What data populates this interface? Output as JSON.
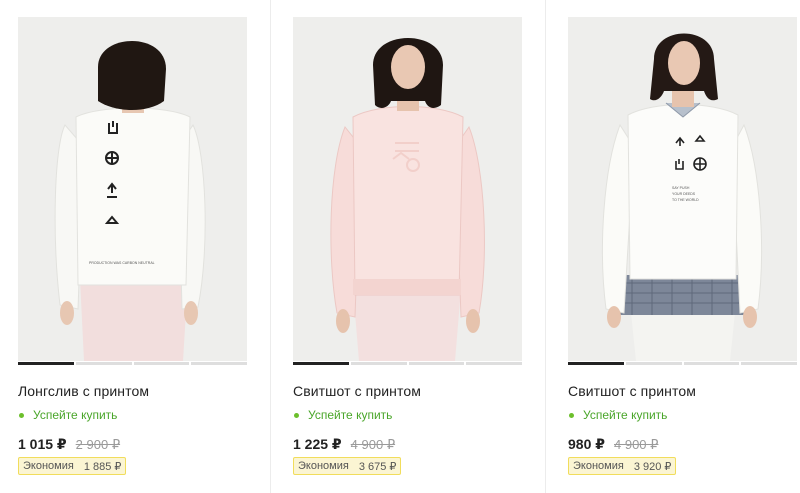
{
  "products": [
    {
      "title": "Лонгслив с принтом",
      "status": "Успейте купить",
      "price": "1 015 ₽",
      "old_price": "2 900 ₽",
      "savings_label": "Экономия",
      "savings_value": "1 885 ₽",
      "image_icon": "woman-back-white-longsleeve",
      "active_slide": 0
    },
    {
      "title": "Свитшот с принтом",
      "status": "Успейте купить",
      "price": "1 225 ₽",
      "old_price": "4 900 ₽",
      "savings_label": "Экономия",
      "savings_value": "3 675 ₽",
      "image_icon": "woman-front-pink-sweatshirt",
      "active_slide": 0
    },
    {
      "title": "Свитшот с принтом",
      "status": "Успейте купить",
      "price": "980 ₽",
      "old_price": "4 900 ₽",
      "savings_label": "Экономия",
      "savings_value": "3 920 ₽",
      "image_icon": "woman-front-white-sweatshirt",
      "active_slide": 0
    }
  ],
  "colors": {
    "status_green": "#4aa62a",
    "savings_bg": "#fbf5d3",
    "savings_border": "#f1dd5c"
  }
}
